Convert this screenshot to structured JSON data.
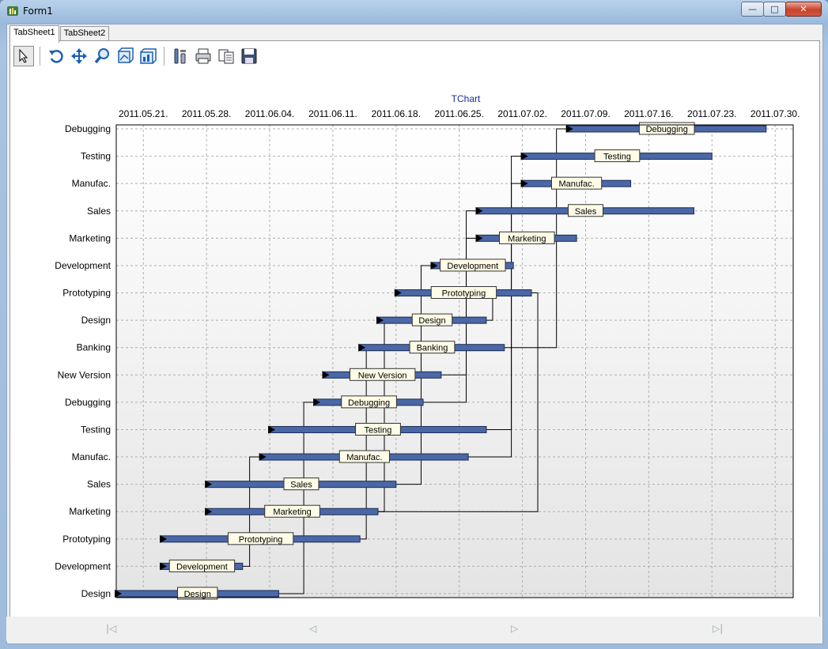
{
  "window": {
    "title": "Form1"
  },
  "tabs": [
    {
      "label": "TabSheet1",
      "active": true
    },
    {
      "label": "TabSheet2",
      "active": false
    }
  ],
  "toolbar": {
    "buttons": [
      {
        "name": "select-tool-icon"
      },
      {
        "name": "rotate-icon"
      },
      {
        "name": "move-icon"
      },
      {
        "name": "zoom-icon"
      },
      {
        "name": "depth-icon"
      },
      {
        "name": "3d-view-icon"
      },
      {
        "name": "edit-chart-icon"
      },
      {
        "name": "print-icon"
      },
      {
        "name": "copy-icon"
      },
      {
        "name": "save-icon"
      }
    ]
  },
  "chart_data": {
    "type": "gantt",
    "title": "TChart",
    "x_ticks": [
      "2011.05.21.",
      "2011.05.28.",
      "2011.06.04.",
      "2011.06.11.",
      "2011.06.18.",
      "2011.06.25.",
      "2011.07.02.",
      "2011.07.09.",
      "2011.07.16.",
      "2011.07.23.",
      "2011.07.30."
    ],
    "xlim": [
      "2011-05-18",
      "2011-08-01"
    ],
    "grid": true,
    "colors": {
      "bar": "#4a67a6",
      "title": "#1a2aa0",
      "label_bg": "#fffbe6"
    },
    "tasks": [
      {
        "label": "Design",
        "start": "2011-05-18",
        "end": "2011-06-05",
        "next": 0
      },
      {
        "label": "Development",
        "start": "2011-05-23",
        "end": "2011-06-01",
        "next": 1
      },
      {
        "label": "Prototyping",
        "start": "2011-05-23",
        "end": "2011-06-14",
        "next": 2
      },
      {
        "label": "Marketing",
        "start": "2011-05-28",
        "end": "2011-06-16",
        "next": 3
      },
      {
        "label": "Sales",
        "start": "2011-05-28",
        "end": "2011-06-18",
        "next": 4
      },
      {
        "label": "Manufac.",
        "start": "2011-06-03",
        "end": "2011-06-26",
        "next": 5
      },
      {
        "label": "Testing",
        "start": "2011-06-04",
        "end": "2011-06-28",
        "next": 6
      },
      {
        "label": "Debugging",
        "start": "2011-06-09",
        "end": "2011-06-21",
        "next": 7
      },
      {
        "label": "New Version",
        "start": "2011-06-10",
        "end": "2011-06-23",
        "next": 8
      },
      {
        "label": "Banking",
        "start": "2011-06-14",
        "end": "2011-06-30",
        "next": 9
      },
      {
        "label": "Design",
        "start": "2011-06-16",
        "end": "2011-06-28",
        "next": 10
      },
      {
        "label": "Prototyping",
        "start": "2011-06-18",
        "end": "2011-07-03",
        "next": 11
      },
      {
        "label": "Development",
        "start": "2011-06-22",
        "end": "2011-07-01",
        "next": 12
      },
      {
        "label": "Marketing",
        "start": "2011-06-27",
        "end": "2011-07-08",
        "next": 13
      },
      {
        "label": "Sales",
        "start": "2011-06-27",
        "end": "2011-07-21",
        "next": 14
      },
      {
        "label": "Manufac.",
        "start": "2011-07-02",
        "end": "2011-07-14",
        "next": 15
      },
      {
        "label": "Testing",
        "start": "2011-07-02",
        "end": "2011-07-23",
        "next": 16
      },
      {
        "label": "Debugging",
        "start": "2011-07-07",
        "end": "2011-07-29",
        "next": 17
      }
    ],
    "links": [
      [
        0,
        7
      ],
      [
        1,
        5
      ],
      [
        2,
        9
      ],
      [
        3,
        10
      ],
      [
        4,
        12
      ],
      [
        5,
        16
      ],
      [
        6,
        15
      ],
      [
        7,
        13
      ],
      [
        8,
        14
      ],
      [
        9,
        17
      ],
      [
        10,
        11
      ],
      [
        11,
        3
      ]
    ]
  },
  "nav": [
    "first-page-icon",
    "prev-page-icon",
    "next-page-icon",
    "last-page-icon"
  ]
}
